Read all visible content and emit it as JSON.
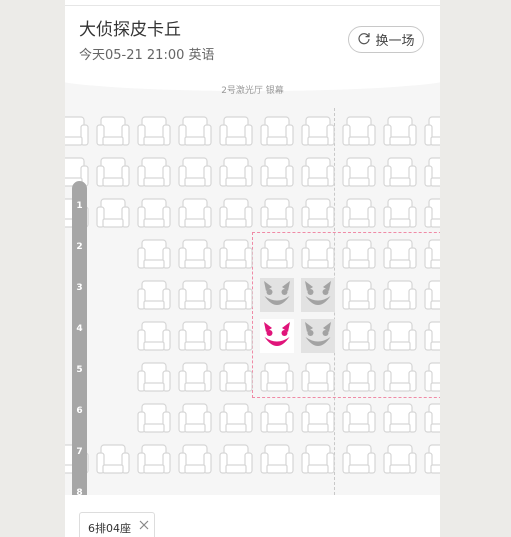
{
  "movie": {
    "title": "大侦探皮卡丘",
    "showtime": "今天05-21 21:00 英语"
  },
  "switch_button": {
    "label": "换一场",
    "icon": "refresh-icon"
  },
  "screen": {
    "label": "2号激光厅 银幕"
  },
  "row_labels": [
    "1",
    "2",
    "3",
    "4",
    "5",
    "6",
    "7",
    "8"
  ],
  "seat_map": {
    "rows": 9,
    "cols": 10,
    "layout": [
      "AAAAAAAAAA",
      "AAAAAAAAAA",
      "AAAAAAAAAA",
      "..AAAAAAAA",
      "..AAASSAAA",
      "..AAAYSAAA",
      "..AAAAAAAA",
      "..AAAAAAAA",
      "AAAAAAAAAA"
    ],
    "legend": {
      "A": "available",
      "S": "sold",
      "Y": "selected"
    }
  },
  "selected_seats": [
    {
      "label": "6排04座",
      "remove_icon": "close-icon"
    }
  ],
  "colors": {
    "selected": "#e0147a",
    "sold": "#a3a3a3",
    "best_area_border": "#f08aa6",
    "row_bar": "#a6a6a6"
  }
}
